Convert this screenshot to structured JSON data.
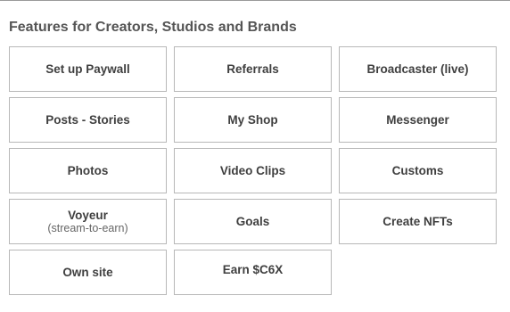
{
  "section": {
    "title": "Features for Creators, Studios and Brands"
  },
  "features": [
    {
      "label": "Set up Paywall"
    },
    {
      "label": "Referrals"
    },
    {
      "label": "Broadcaster (live)"
    },
    {
      "label": "Posts - Stories"
    },
    {
      "label": "My Shop"
    },
    {
      "label": "Messenger"
    },
    {
      "label": "Photos"
    },
    {
      "label": "Video Clips"
    },
    {
      "label": "Customs"
    },
    {
      "label": "Voyeur",
      "sublabel": "(stream-to-earn)"
    },
    {
      "label": "Goals"
    },
    {
      "label": "Create NFTs"
    },
    {
      "label": "Own site"
    },
    {
      "label": "Earn $C6X"
    }
  ]
}
